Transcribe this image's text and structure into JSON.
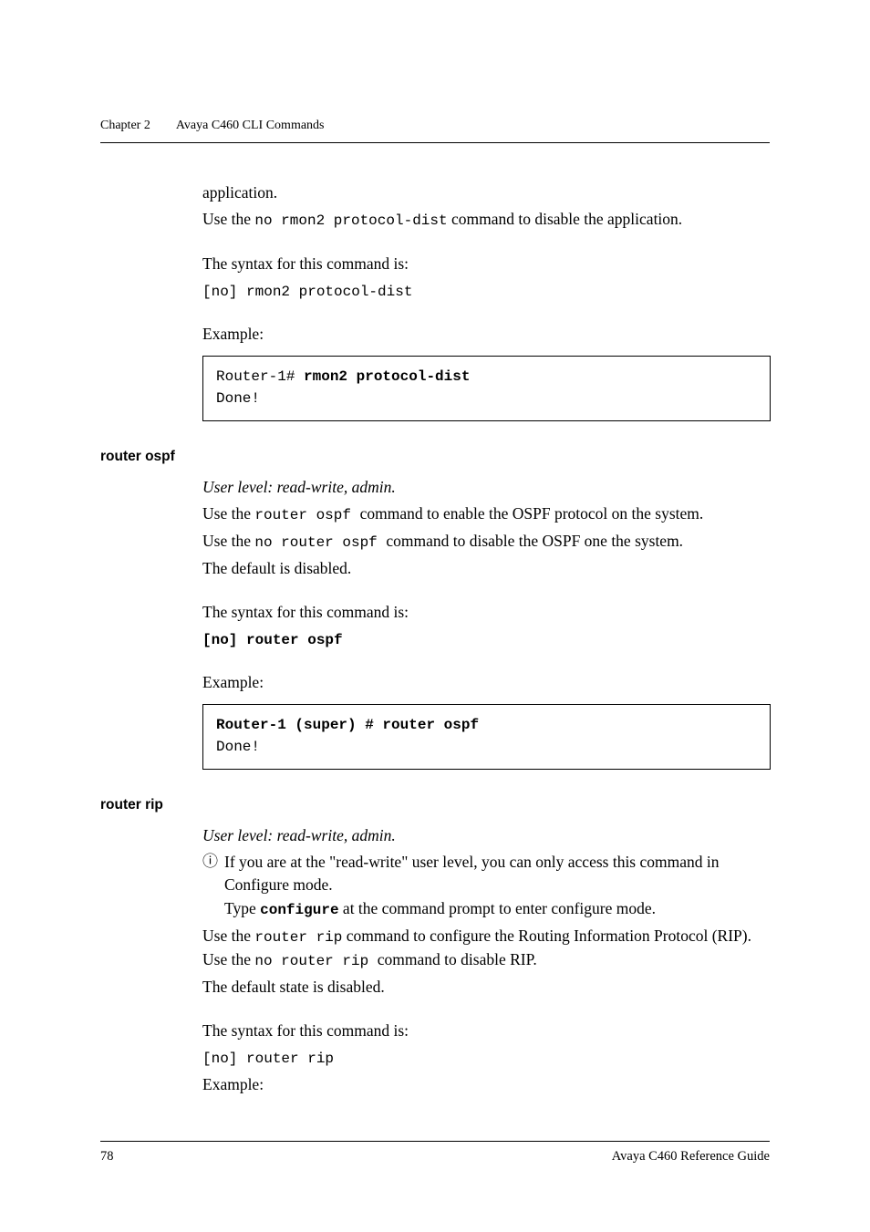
{
  "runhead": {
    "chapter": "Chapter 2",
    "title": "Avaya C460 CLI Commands"
  },
  "s1": {
    "p1a": "application.",
    "p1b_1": "Use the ",
    "p1b_code": "no rmon2 protocol-dist",
    "p1b_2": " command to disable the application.",
    "p2": "The syntax for this command is:",
    "p2_code": "[no] rmon2 protocol-dist",
    "p3": "Example:",
    "code_line1_plain": "Router-1# ",
    "code_line1_bold": "rmon2 protocol-dist",
    "code_line2": "Done!"
  },
  "h1": "router ospf",
  "s2": {
    "ul": "User level: read-write, admin.",
    "p1_1": "Use the ",
    "p1_code": " router ospf ",
    "p1_2": "command to enable the OSPF protocol on the system.",
    "p2_1": "Use the ",
    "p2_code": " no router ospf ",
    "p2_2": "command to disable the OSPF one the system.",
    "p3": "The default is disabled.",
    "p4": "The syntax for this command is:",
    "p4_code": "[no] router ospf",
    "p5": "Example:",
    "code_line1": "Router-1 (super) # router ospf",
    "code_line2": "Done!"
  },
  "h2": "router rip",
  "s3": {
    "ul": "User level: read-write, admin.",
    "info_icon": "ⓘ",
    "info1": "If you are at the \"read-write\" user level, you can only access this command in Configure mode.",
    "info2a": "Type ",
    "info2_code": "configure",
    "info2b": " at the command prompt to enter configure mode.",
    "p1_1": "Use the ",
    "p1_code": "router rip",
    "p1_2": " command to configure the Routing Information Protocol (RIP). Use the ",
    "p1_code2": "no router rip ",
    "p1_3": " command to disable RIP.",
    "p2": "The default state is disabled.",
    "p3": "The syntax for this command is:",
    "p3_code": "[no] router rip",
    "p4": "Example:"
  },
  "footer": {
    "page": "78",
    "doc": "Avaya C460 Reference Guide"
  }
}
